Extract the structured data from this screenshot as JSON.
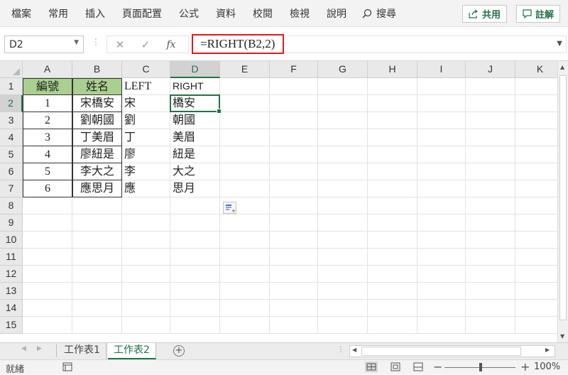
{
  "menu": {
    "items": [
      "檔案",
      "常用",
      "插入",
      "頁面配置",
      "公式",
      "資料",
      "校閱",
      "檢視",
      "說明"
    ],
    "search": "搜尋",
    "share": "共用",
    "comments": "註解"
  },
  "formula_bar": {
    "name_box": "D2",
    "fx": "fx",
    "formula": "=RIGHT(B2,2)"
  },
  "grid": {
    "columns": [
      "A",
      "B",
      "C",
      "D",
      "E",
      "F",
      "G",
      "H",
      "I",
      "J",
      "K"
    ],
    "rows": [
      "1",
      "2",
      "3",
      "4",
      "5",
      "6",
      "7",
      "8",
      "9",
      "10",
      "11",
      "12",
      "13",
      "14",
      "15"
    ],
    "selected_column": "D",
    "selected_row": "2",
    "header_row": [
      "編號",
      "姓名",
      "LEFT",
      "RIGHT"
    ],
    "data_rows": [
      [
        "1",
        "宋橋安",
        "宋",
        "橋安"
      ],
      [
        "2",
        "劉朝國",
        "劉",
        "朝國"
      ],
      [
        "3",
        "丁美眉",
        "丁",
        "美眉"
      ],
      [
        "4",
        "廖紐是",
        "廖",
        "紐是"
      ],
      [
        "5",
        "李大之",
        "李",
        "大之"
      ],
      [
        "6",
        "應思月",
        "應",
        "思月"
      ]
    ],
    "header_fill_color": "#a9d08e",
    "selection_color": "#217346"
  },
  "sheets": {
    "tabs": [
      "工作表1",
      "工作表2"
    ],
    "active": "工作表2",
    "add_icon": "plus-circle-icon"
  },
  "status": {
    "ready": "就緒",
    "zoom": "100%"
  }
}
